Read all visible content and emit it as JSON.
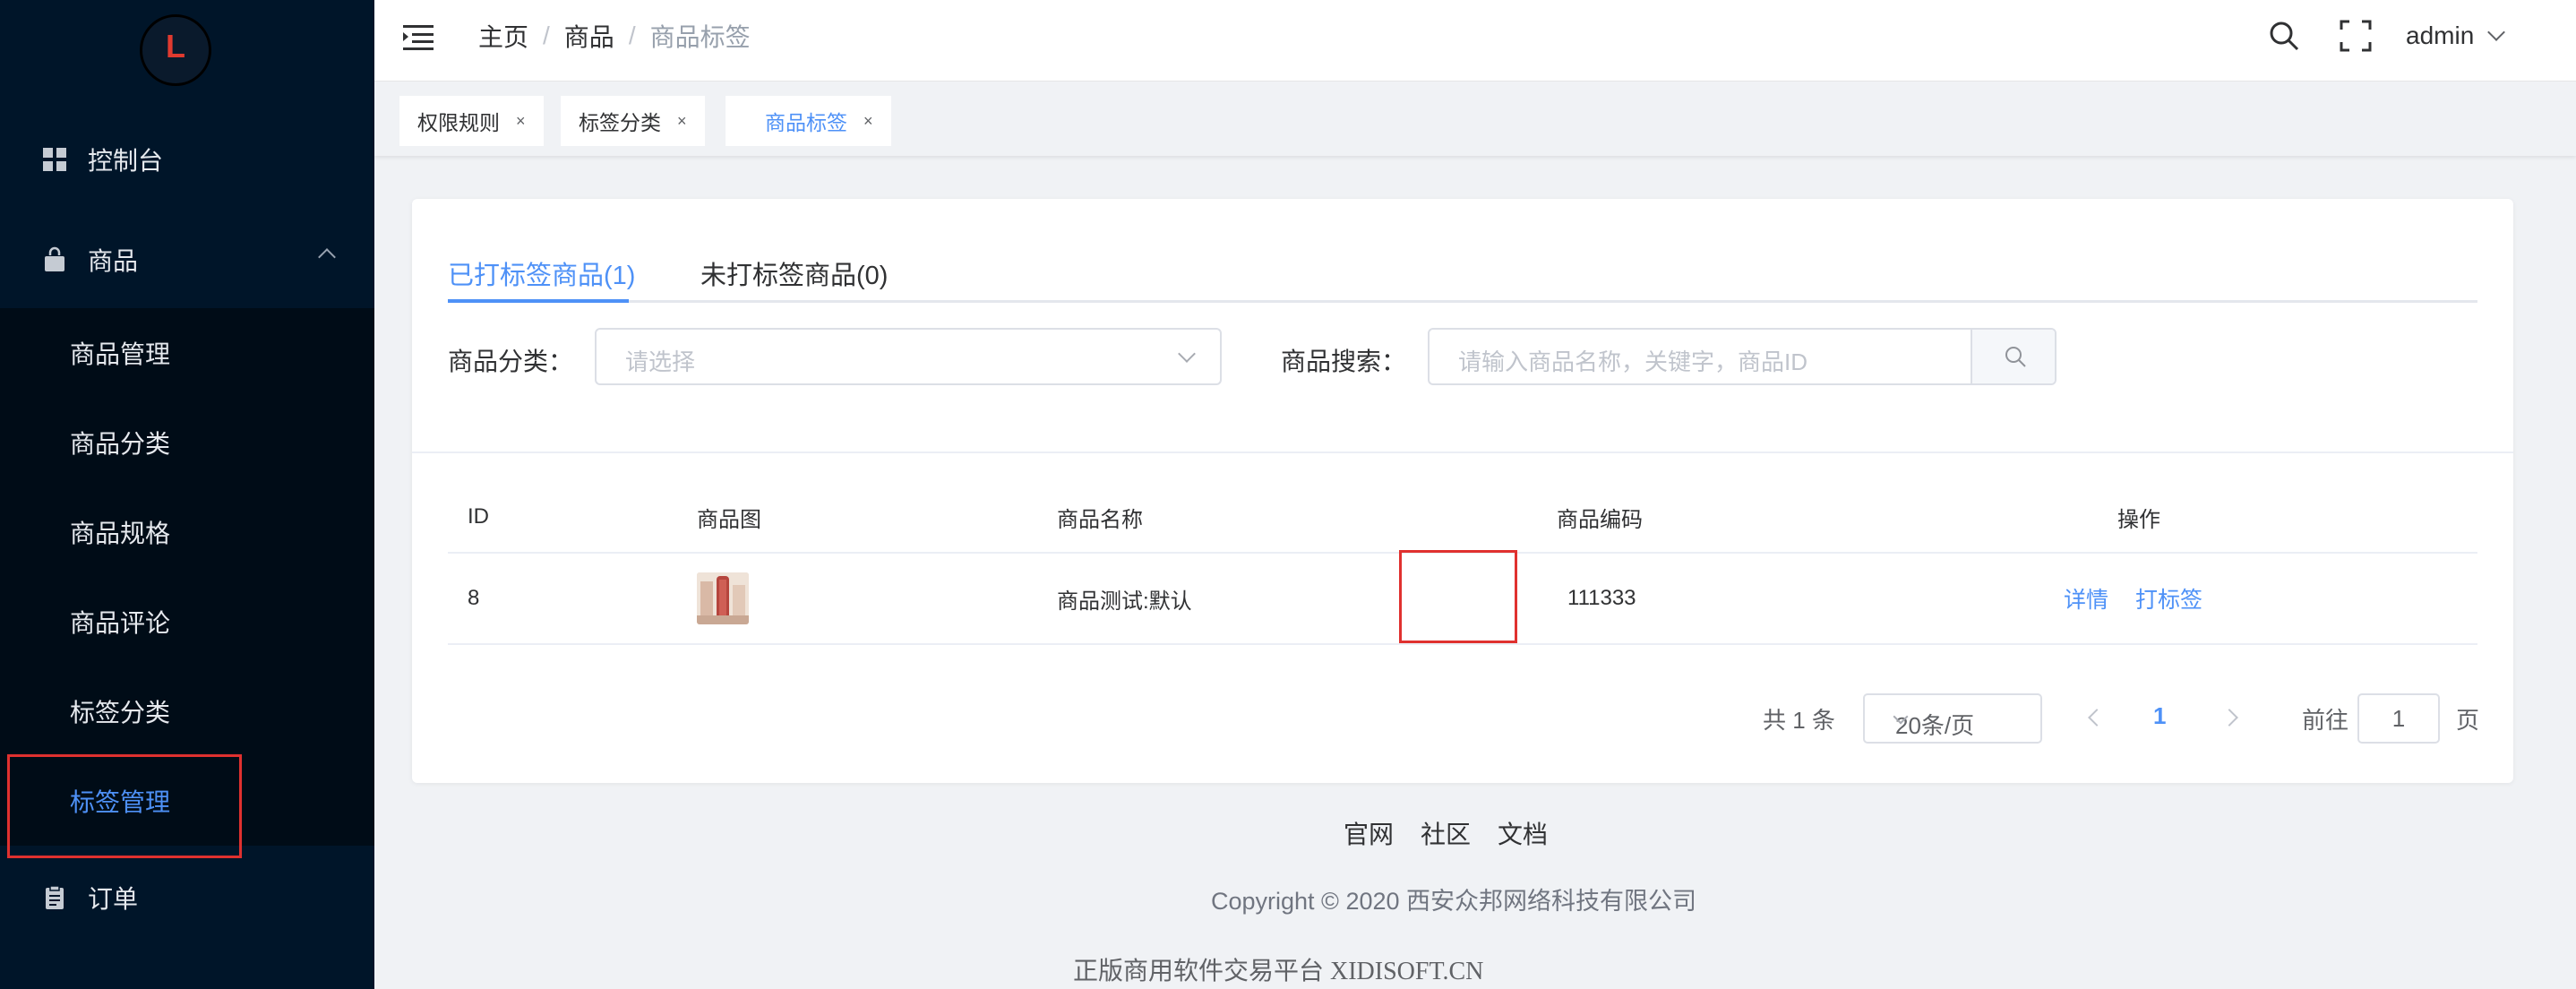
{
  "sidebar": {
    "logo_letter": "L",
    "menu": {
      "dashboard": "控制台",
      "goods": "商品",
      "order": "订单"
    },
    "submenu": [
      {
        "label": "商品管理"
      },
      {
        "label": "商品分类"
      },
      {
        "label": "商品规格"
      },
      {
        "label": "商品评论"
      },
      {
        "label": "标签分类"
      },
      {
        "label": "标签管理"
      }
    ]
  },
  "header": {
    "breadcrumb": [
      "主页",
      "商品",
      "商品标签"
    ],
    "separator": "/",
    "user": "admin"
  },
  "tags": [
    {
      "label": "权限规则",
      "close": "×"
    },
    {
      "label": "标签分类",
      "close": "×"
    },
    {
      "label": "商品标签",
      "close": "×"
    }
  ],
  "tabs": [
    {
      "label": "已打标签商品(1)"
    },
    {
      "label": "未打标签商品(0)"
    }
  ],
  "filters": {
    "category_label": "商品分类：",
    "category_placeholder": "请选择",
    "search_label": "商品搜索：",
    "search_placeholder": "请输入商品名称，关键字，商品ID"
  },
  "table": {
    "columns": [
      "ID",
      "商品图",
      "商品名称",
      "商品编码",
      "操作"
    ],
    "rows": [
      {
        "id": "8",
        "name": "商品测试:默认",
        "code": "111333",
        "actions": [
          "详情",
          "打标签"
        ]
      }
    ]
  },
  "pagination": {
    "total": "共 1 条",
    "page_size": "20条/页",
    "current": "1",
    "goto_label": "前往",
    "goto_value": "1",
    "page_suffix": "页"
  },
  "footer": {
    "links": [
      "官网",
      "社区",
      "文档"
    ],
    "copyright": "Copyright © 2020 西安众邦网络科技有限公司",
    "platform": "正版商用软件交易平台 XIDISOFT.CN"
  },
  "colors": {
    "sidebar_bg": "#001529",
    "accent": "#4e91f7",
    "highlight_border": "#e0312f"
  }
}
